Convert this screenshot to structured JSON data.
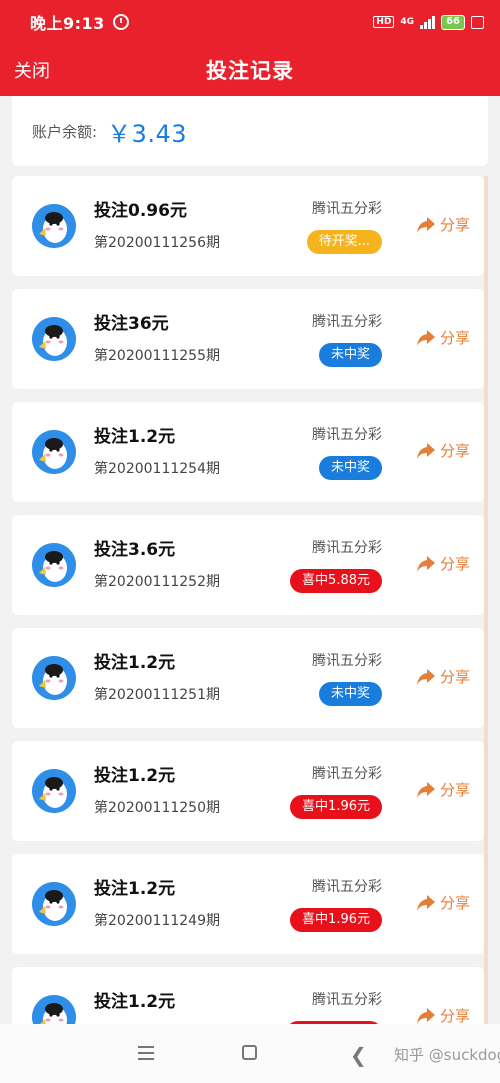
{
  "status_bar": {
    "time": "晚上9:13",
    "hd": "HD",
    "network": "4G",
    "battery": "66"
  },
  "nav": {
    "close_label": "关闭",
    "title": "投注记录"
  },
  "balance": {
    "label": "账户余额:",
    "value": "￥3.43"
  },
  "colors": {
    "brand_red": "#e8212d",
    "pending": "#f5b41e",
    "no_win": "#1a7cdd",
    "win": "#e8101a",
    "share": "#e47f3a",
    "balance": "#1a7cdd"
  },
  "share_label": "分享",
  "bets": [
    {
      "amount": "投注0.96元",
      "period": "第20200111256期",
      "game": "腾讯五分彩",
      "status": "待开奖...",
      "status_type": "pending"
    },
    {
      "amount": "投注36元",
      "period": "第20200111255期",
      "game": "腾讯五分彩",
      "status": "未中奖",
      "status_type": "no_win"
    },
    {
      "amount": "投注1.2元",
      "period": "第20200111254期",
      "game": "腾讯五分彩",
      "status": "未中奖",
      "status_type": "no_win"
    },
    {
      "amount": "投注3.6元",
      "period": "第20200111252期",
      "game": "腾讯五分彩",
      "status": "喜中5.88元",
      "status_type": "win"
    },
    {
      "amount": "投注1.2元",
      "period": "第20200111251期",
      "game": "腾讯五分彩",
      "status": "未中奖",
      "status_type": "no_win"
    },
    {
      "amount": "投注1.2元",
      "period": "第20200111250期",
      "game": "腾讯五分彩",
      "status": "喜中1.96元",
      "status_type": "win"
    },
    {
      "amount": "投注1.2元",
      "period": "第20200111249期",
      "game": "腾讯五分彩",
      "status": "喜中1.96元",
      "status_type": "win"
    },
    {
      "amount": "投注1.2元",
      "period": "",
      "game": "腾讯五分彩",
      "status": "",
      "status_type": "win"
    }
  ],
  "bottom": {
    "watermark": "知乎 @suckdog"
  }
}
